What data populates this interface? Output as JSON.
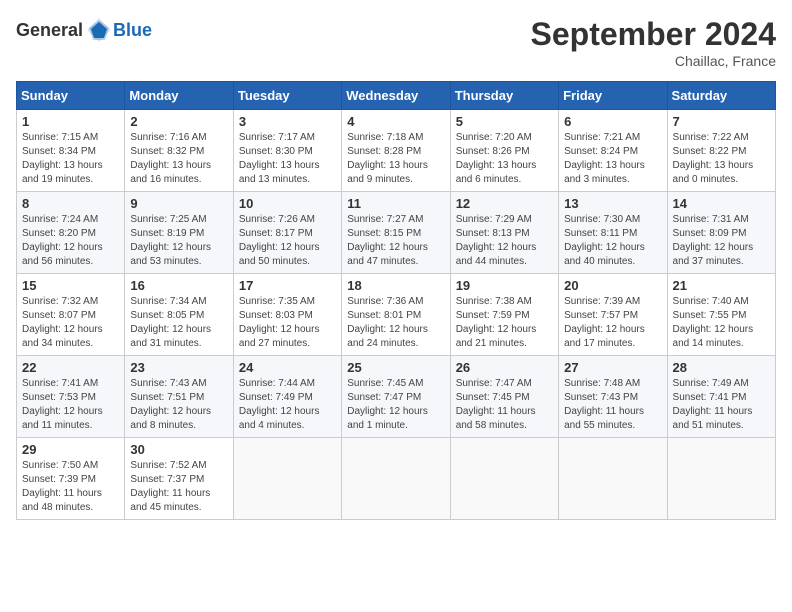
{
  "header": {
    "logo_general": "General",
    "logo_blue": "Blue",
    "month_title": "September 2024",
    "location": "Chaillac, France"
  },
  "weekdays": [
    "Sunday",
    "Monday",
    "Tuesday",
    "Wednesday",
    "Thursday",
    "Friday",
    "Saturday"
  ],
  "weeks": [
    [
      {
        "day": "1",
        "info": "Sunrise: 7:15 AM\nSunset: 8:34 PM\nDaylight: 13 hours\nand 19 minutes."
      },
      {
        "day": "2",
        "info": "Sunrise: 7:16 AM\nSunset: 8:32 PM\nDaylight: 13 hours\nand 16 minutes."
      },
      {
        "day": "3",
        "info": "Sunrise: 7:17 AM\nSunset: 8:30 PM\nDaylight: 13 hours\nand 13 minutes."
      },
      {
        "day": "4",
        "info": "Sunrise: 7:18 AM\nSunset: 8:28 PM\nDaylight: 13 hours\nand 9 minutes."
      },
      {
        "day": "5",
        "info": "Sunrise: 7:20 AM\nSunset: 8:26 PM\nDaylight: 13 hours\nand 6 minutes."
      },
      {
        "day": "6",
        "info": "Sunrise: 7:21 AM\nSunset: 8:24 PM\nDaylight: 13 hours\nand 3 minutes."
      },
      {
        "day": "7",
        "info": "Sunrise: 7:22 AM\nSunset: 8:22 PM\nDaylight: 13 hours\nand 0 minutes."
      }
    ],
    [
      {
        "day": "8",
        "info": "Sunrise: 7:24 AM\nSunset: 8:20 PM\nDaylight: 12 hours\nand 56 minutes."
      },
      {
        "day": "9",
        "info": "Sunrise: 7:25 AM\nSunset: 8:19 PM\nDaylight: 12 hours\nand 53 minutes."
      },
      {
        "day": "10",
        "info": "Sunrise: 7:26 AM\nSunset: 8:17 PM\nDaylight: 12 hours\nand 50 minutes."
      },
      {
        "day": "11",
        "info": "Sunrise: 7:27 AM\nSunset: 8:15 PM\nDaylight: 12 hours\nand 47 minutes."
      },
      {
        "day": "12",
        "info": "Sunrise: 7:29 AM\nSunset: 8:13 PM\nDaylight: 12 hours\nand 44 minutes."
      },
      {
        "day": "13",
        "info": "Sunrise: 7:30 AM\nSunset: 8:11 PM\nDaylight: 12 hours\nand 40 minutes."
      },
      {
        "day": "14",
        "info": "Sunrise: 7:31 AM\nSunset: 8:09 PM\nDaylight: 12 hours\nand 37 minutes."
      }
    ],
    [
      {
        "day": "15",
        "info": "Sunrise: 7:32 AM\nSunset: 8:07 PM\nDaylight: 12 hours\nand 34 minutes."
      },
      {
        "day": "16",
        "info": "Sunrise: 7:34 AM\nSunset: 8:05 PM\nDaylight: 12 hours\nand 31 minutes."
      },
      {
        "day": "17",
        "info": "Sunrise: 7:35 AM\nSunset: 8:03 PM\nDaylight: 12 hours\nand 27 minutes."
      },
      {
        "day": "18",
        "info": "Sunrise: 7:36 AM\nSunset: 8:01 PM\nDaylight: 12 hours\nand 24 minutes."
      },
      {
        "day": "19",
        "info": "Sunrise: 7:38 AM\nSunset: 7:59 PM\nDaylight: 12 hours\nand 21 minutes."
      },
      {
        "day": "20",
        "info": "Sunrise: 7:39 AM\nSunset: 7:57 PM\nDaylight: 12 hours\nand 17 minutes."
      },
      {
        "day": "21",
        "info": "Sunrise: 7:40 AM\nSunset: 7:55 PM\nDaylight: 12 hours\nand 14 minutes."
      }
    ],
    [
      {
        "day": "22",
        "info": "Sunrise: 7:41 AM\nSunset: 7:53 PM\nDaylight: 12 hours\nand 11 minutes."
      },
      {
        "day": "23",
        "info": "Sunrise: 7:43 AM\nSunset: 7:51 PM\nDaylight: 12 hours\nand 8 minutes."
      },
      {
        "day": "24",
        "info": "Sunrise: 7:44 AM\nSunset: 7:49 PM\nDaylight: 12 hours\nand 4 minutes."
      },
      {
        "day": "25",
        "info": "Sunrise: 7:45 AM\nSunset: 7:47 PM\nDaylight: 12 hours\nand 1 minute."
      },
      {
        "day": "26",
        "info": "Sunrise: 7:47 AM\nSunset: 7:45 PM\nDaylight: 11 hours\nand 58 minutes."
      },
      {
        "day": "27",
        "info": "Sunrise: 7:48 AM\nSunset: 7:43 PM\nDaylight: 11 hours\nand 55 minutes."
      },
      {
        "day": "28",
        "info": "Sunrise: 7:49 AM\nSunset: 7:41 PM\nDaylight: 11 hours\nand 51 minutes."
      }
    ],
    [
      {
        "day": "29",
        "info": "Sunrise: 7:50 AM\nSunset: 7:39 PM\nDaylight: 11 hours\nand 48 minutes."
      },
      {
        "day": "30",
        "info": "Sunrise: 7:52 AM\nSunset: 7:37 PM\nDaylight: 11 hours\nand 45 minutes."
      },
      {
        "day": "",
        "info": ""
      },
      {
        "day": "",
        "info": ""
      },
      {
        "day": "",
        "info": ""
      },
      {
        "day": "",
        "info": ""
      },
      {
        "day": "",
        "info": ""
      }
    ]
  ]
}
